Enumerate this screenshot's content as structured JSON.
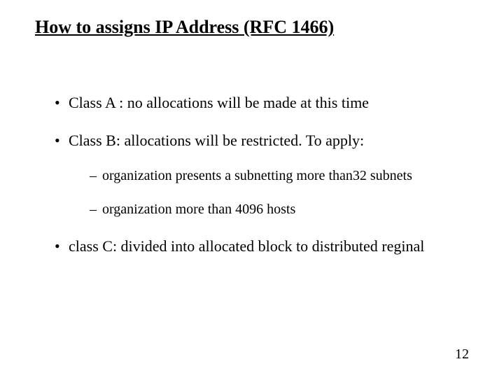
{
  "title": {
    "bold_underline": "How to assigns IP Address",
    "rest_underline": " (RFC 1466)"
  },
  "bullets": {
    "a": "Class A : no allocations will be made at this time",
    "b": "Class B: allocations will be restricted. To apply:",
    "b_sub1": "organization presents a subnetting more than32 subnets",
    "b_sub2": "organization more than 4096 hosts",
    "c": "class C: divided into allocated block to distributed reginal"
  },
  "page_number": "12"
}
